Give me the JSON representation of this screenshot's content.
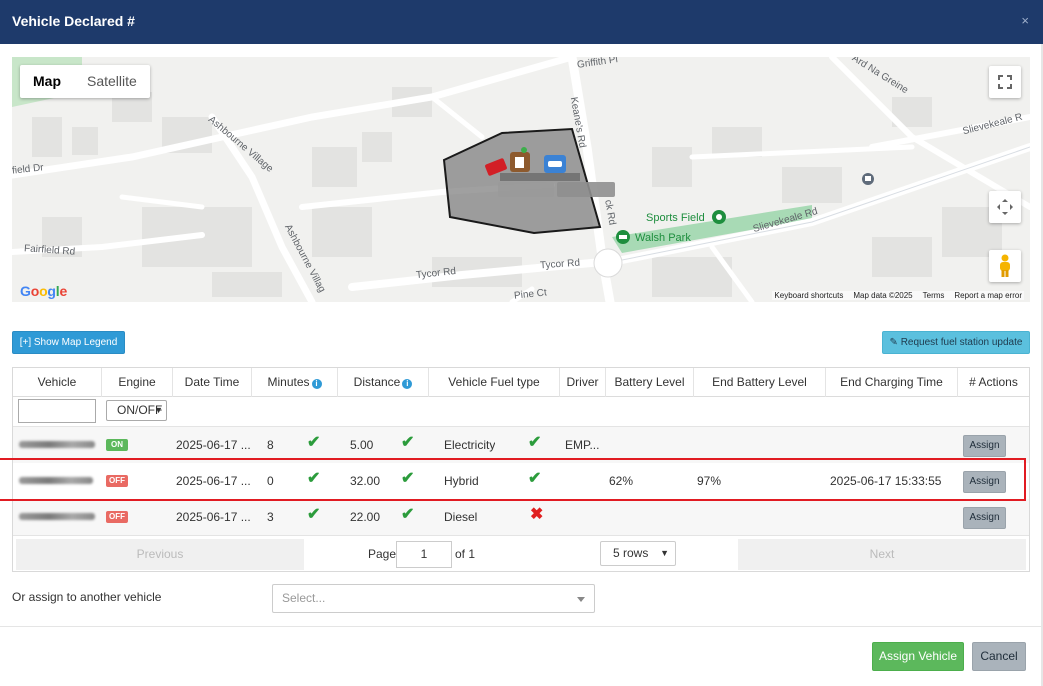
{
  "modal": {
    "title": "Vehicle Declared #",
    "close_glyph": "×"
  },
  "map": {
    "type_buttons": [
      "Map",
      "Satellite"
    ],
    "street_labels": {
      "griffith": "Griffith Pl",
      "ard_na_greine": "Ard Na Greine",
      "slievekeale_top": "Slievekeale R",
      "slievekeale_mid": "Slievekeale Rd",
      "keanes": "Keane's Rd",
      "ashbourne_village": "Ashbourne Village",
      "ashbourne_village_2": "Ashbourne Villag",
      "field_dr": "field Dr",
      "fairfield": "Fairfield Rd",
      "tycor_1": "Tycor Rd",
      "tycor_2": "Tycor Rd",
      "pine_ct": "Pine Ct",
      "sports_field": "Sports Field",
      "walsh_park": "Walsh Park",
      "ck_rd": "ck Rd"
    },
    "google_logo": "Google",
    "footer": [
      "Keyboard shortcuts",
      "Map data ©2025",
      "Terms",
      "Report a map error"
    ],
    "icons": [
      "fullscreen-icon",
      "camera-control-icon",
      "pegman-icon",
      "car-icon",
      "fuel-station-icon",
      "ev-charger-icon",
      "bus-stop-icon"
    ],
    "colors": {
      "polygon_fill": "#7b7b7b",
      "park_green": "#a8dab5",
      "road": "#ffffff"
    }
  },
  "buttons": {
    "show_legend": "[+] Show Map Legend",
    "request_update": "Request fuel station update",
    "assign_vehicle": "Assign Vehicle",
    "cancel": "Cancel"
  },
  "table": {
    "headers": [
      "Vehicle",
      "Engine",
      "Date Time",
      "Minutes",
      "Distance",
      "Vehicle Fuel type",
      "Driver",
      "Battery Level",
      "End Battery Level",
      "End Charging Time",
      "# Actions"
    ],
    "engine_filter": "ON/OFF",
    "rows": [
      {
        "vehicle": "",
        "engine": "ON",
        "datetime": "2025-06-17 ...",
        "minutes": "8",
        "minutes_ok": true,
        "distance": "5.00",
        "distance_ok": true,
        "fuel": "Electricity",
        "fuel_ok": true,
        "driver": "EMP...",
        "battery": "",
        "end_battery": "",
        "end_charging": "",
        "action": "Assign"
      },
      {
        "vehicle": "",
        "engine": "OFF",
        "datetime": "2025-06-17 ...",
        "minutes": "0",
        "minutes_ok": true,
        "distance": "32.00",
        "distance_ok": true,
        "fuel": "Hybrid",
        "fuel_ok": true,
        "driver": "",
        "battery": "62%",
        "end_battery": "97%",
        "end_charging": "2025-06-17 15:33:55",
        "action": "Assign"
      },
      {
        "vehicle": "",
        "engine": "OFF",
        "datetime": "2025-06-17 ...",
        "minutes": "3",
        "minutes_ok": true,
        "distance": "22.00",
        "distance_ok": true,
        "fuel": "Diesel",
        "fuel_ok": false,
        "driver": "",
        "battery": "",
        "end_battery": "",
        "end_charging": "",
        "action": "Assign"
      }
    ],
    "pager": {
      "previous": "Previous",
      "page_label": "Page",
      "page": "1",
      "of_label": "of 1",
      "rows_option": "5 rows",
      "next": "Next"
    }
  },
  "assign_other": {
    "label": "Or assign to another vehicle",
    "placeholder": "Select..."
  },
  "status_colors": {
    "ok": "#2c9c3c",
    "fail": "#e02020",
    "highlight": "#e11b22",
    "engine_on": "#5cb85c",
    "engine_off": "#e96a63"
  }
}
